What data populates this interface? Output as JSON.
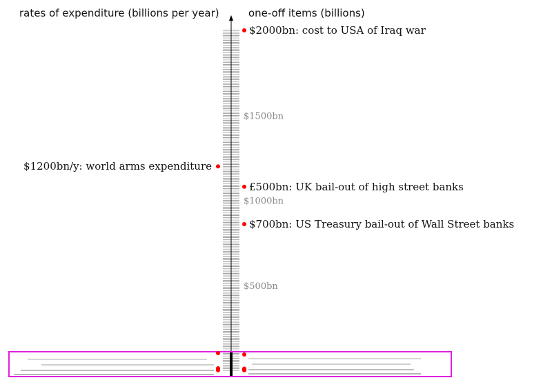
{
  "headers": {
    "left": "rates of expenditure (billions per year)",
    "right": "one-off items (billions)"
  },
  "chart_data": {
    "type": "scatter",
    "title": "",
    "xlabel": "",
    "ylabel": "",
    "ylim": [
      0,
      2000
    ],
    "scale_tick_labels": [
      "$500bn",
      "$1000bn",
      "$1500bn"
    ],
    "scale_tick_values": [
      500,
      1000,
      1500
    ],
    "left_series_name": "rates of expenditure (billions per year)",
    "right_series_name": "one-off items (billions)",
    "left_items": [
      {
        "label": "$1200bn/y: world arms expenditure",
        "value": 1200
      }
    ],
    "right_items": [
      {
        "label": "$2000bn: cost to USA of Iraq war",
        "value": 2000
      },
      {
        "label": "£500bn: UK bail-out of high street banks",
        "value": 1080
      },
      {
        "label": "$700bn: US Treasury bail-out of Wall Street banks",
        "value": 860
      }
    ],
    "small_items_left": [
      12,
      8,
      5,
      3,
      1
    ],
    "small_items_right": [
      10,
      6,
      3,
      2,
      1
    ],
    "colors": {
      "dot": "#ff0000",
      "highlight_box": "#e020e0",
      "tick_label": "#888888",
      "axis": "#000000"
    }
  }
}
